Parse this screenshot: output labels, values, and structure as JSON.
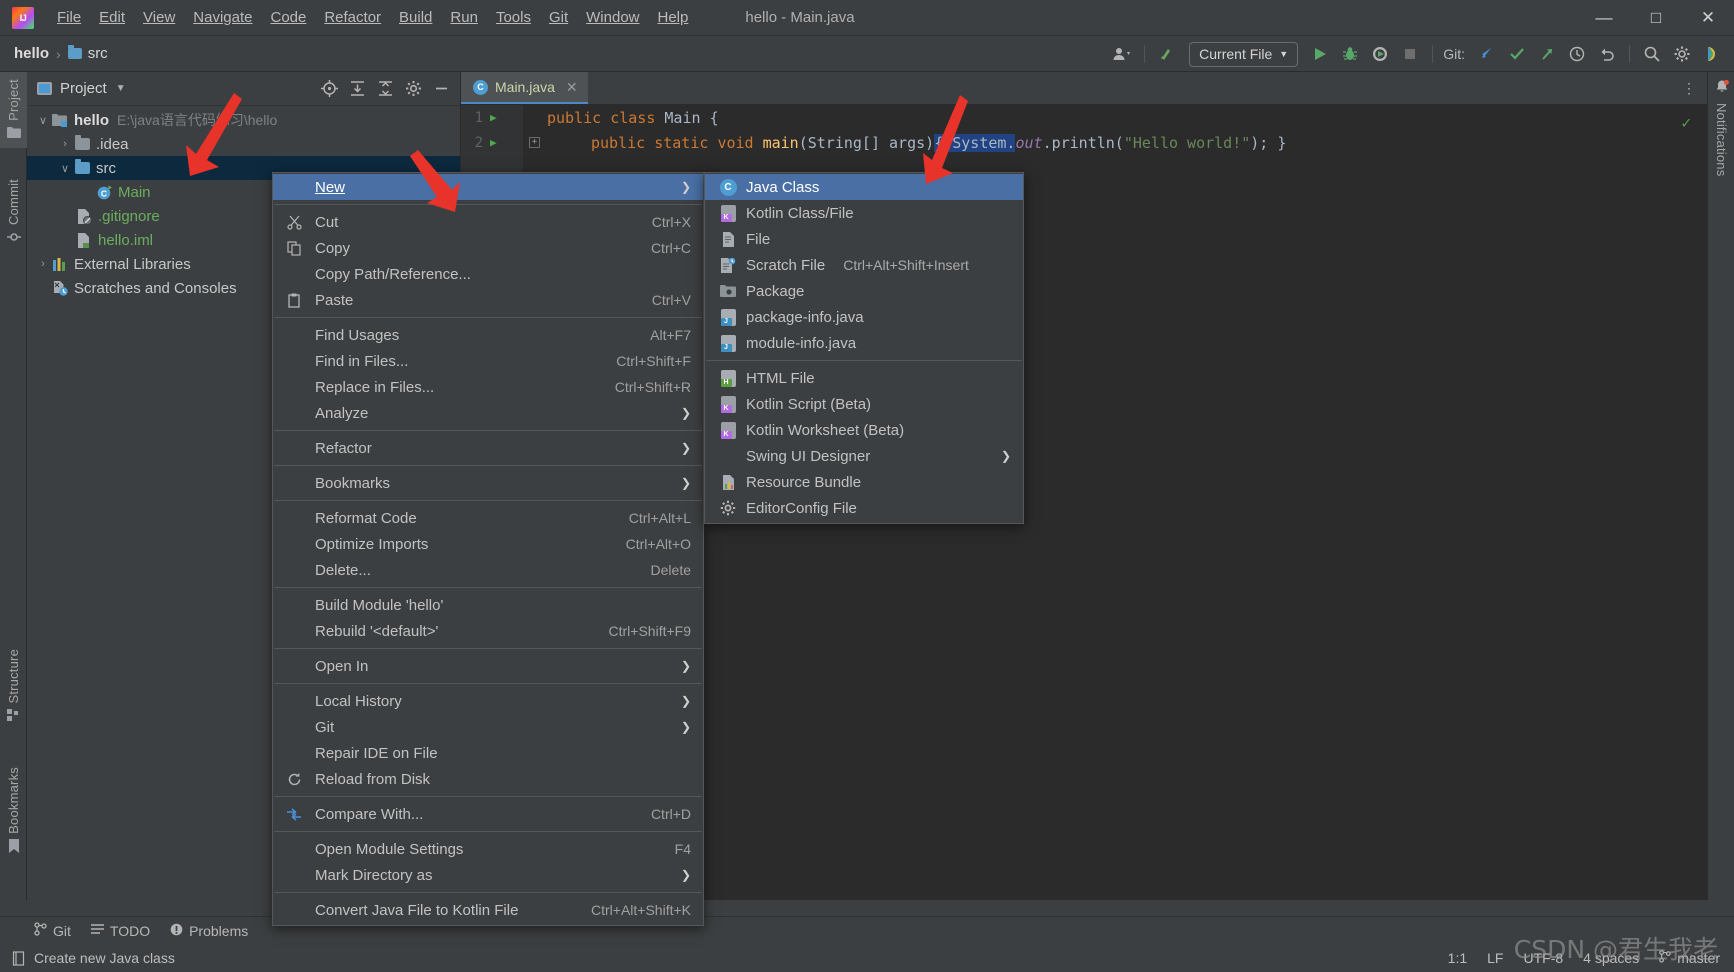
{
  "window": {
    "title": "hello - Main.java",
    "minimize": "—",
    "maximize": "□",
    "close": "✕"
  },
  "menubar": {
    "items": [
      {
        "label": "File"
      },
      {
        "label": "Edit"
      },
      {
        "label": "View"
      },
      {
        "label": "Navigate"
      },
      {
        "label": "Code"
      },
      {
        "label": "Refactor"
      },
      {
        "label": "Build"
      },
      {
        "label": "Run"
      },
      {
        "label": "Tools"
      },
      {
        "label": "Git"
      },
      {
        "label": "Window"
      },
      {
        "label": "Help"
      }
    ]
  },
  "navbar": {
    "breadcrumb": {
      "project": "hello",
      "separator": "›",
      "folder": "src"
    },
    "run_config": "Current File",
    "git_label": "Git:"
  },
  "left_strip": {
    "top": [
      {
        "label": "Project",
        "icon": "project-icon",
        "active": true
      },
      {
        "label": "Commit",
        "icon": "commit-icon",
        "active": false
      }
    ],
    "bottom": [
      {
        "label": "Structure",
        "icon": "structure-icon"
      },
      {
        "label": "Bookmarks",
        "icon": "bookmark-icon"
      }
    ]
  },
  "right_strip": {
    "items": [
      {
        "label": "Notifications",
        "icon": "bell-icon"
      }
    ]
  },
  "project_panel": {
    "title": "Project",
    "tree": [
      {
        "indent": 0,
        "twisty": "∨",
        "icon": "module-icon",
        "label": "hello",
        "bold": true,
        "path": "E:\\java语言代码练习\\hello",
        "selected": false
      },
      {
        "indent": 1,
        "twisty": "›",
        "icon": "folder-gray",
        "label": ".idea",
        "bold": false,
        "path": "",
        "selected": false
      },
      {
        "indent": 1,
        "twisty": "∨",
        "icon": "folder-blue",
        "label": "src",
        "bold": false,
        "path": "",
        "selected": true
      },
      {
        "indent": 2,
        "twisty": "",
        "icon": "class-icon",
        "label": "Main",
        "bold": false,
        "path": "",
        "selected": false,
        "green": true
      },
      {
        "indent": 1,
        "twisty": "",
        "icon": "gitignore-icon",
        "label": ".gitignore",
        "bold": false,
        "path": "",
        "selected": false,
        "green": true
      },
      {
        "indent": 1,
        "twisty": "",
        "icon": "iml-icon",
        "label": "hello.iml",
        "bold": false,
        "path": "",
        "selected": false,
        "green": true
      },
      {
        "indent": 0,
        "twisty": "›",
        "icon": "libraries-icon",
        "label": "External Libraries",
        "bold": false,
        "path": "",
        "selected": false
      },
      {
        "indent": 0,
        "twisty": "",
        "icon": "scratches-icon",
        "label": "Scratches and Consoles",
        "bold": false,
        "path": "",
        "selected": false
      }
    ]
  },
  "editor": {
    "tab": {
      "label": "Main.java",
      "close": "✕"
    },
    "lines": [
      {
        "number": "1",
        "has_run": true,
        "has_fold": false
      },
      {
        "number": "2",
        "has_run": true,
        "has_fold": true
      }
    ],
    "code": {
      "l1_kw1": "public",
      "l1_kw2": "class",
      "l1_name": "Main",
      "l1_brace": "{",
      "l2_kw1": "public",
      "l2_kw2": "static",
      "l2_kw3": "void",
      "l2_name": "main",
      "l2_params": "(String[] args)",
      "l2_body": "{ System.",
      "l2_field": "out",
      "l2_call": ".println(",
      "l2_str": "\"Hello world!\"",
      "l2_tail": "); }"
    }
  },
  "context_menu": {
    "items": [
      {
        "label": "New",
        "accel": "",
        "icon": "",
        "arrow": true,
        "highlight": true,
        "sep_after": true,
        "mnemonic": "N"
      },
      {
        "label": "Cut",
        "accel": "Ctrl+X",
        "icon": "scissors-icon",
        "arrow": false,
        "highlight": false,
        "sep_after": false
      },
      {
        "label": "Copy",
        "accel": "Ctrl+C",
        "icon": "copy-icon",
        "arrow": false,
        "highlight": false,
        "sep_after": false
      },
      {
        "label": "Copy Path/Reference...",
        "accel": "",
        "icon": "",
        "arrow": false,
        "highlight": false,
        "sep_after": false
      },
      {
        "label": "Paste",
        "accel": "Ctrl+V",
        "icon": "clipboard-icon",
        "arrow": false,
        "highlight": false,
        "sep_after": true
      },
      {
        "label": "Find Usages",
        "accel": "Alt+F7",
        "icon": "",
        "arrow": false,
        "highlight": false,
        "sep_after": false
      },
      {
        "label": "Find in Files...",
        "accel": "Ctrl+Shift+F",
        "icon": "",
        "arrow": false,
        "highlight": false,
        "sep_after": false
      },
      {
        "label": "Replace in Files...",
        "accel": "Ctrl+Shift+R",
        "icon": "",
        "arrow": false,
        "highlight": false,
        "sep_after": false
      },
      {
        "label": "Analyze",
        "accel": "",
        "icon": "",
        "arrow": true,
        "highlight": false,
        "sep_after": true
      },
      {
        "label": "Refactor",
        "accel": "",
        "icon": "",
        "arrow": true,
        "highlight": false,
        "sep_after": true
      },
      {
        "label": "Bookmarks",
        "accel": "",
        "icon": "",
        "arrow": true,
        "highlight": false,
        "sep_after": true
      },
      {
        "label": "Reformat Code",
        "accel": "Ctrl+Alt+L",
        "icon": "",
        "arrow": false,
        "highlight": false,
        "sep_after": false
      },
      {
        "label": "Optimize Imports",
        "accel": "Ctrl+Alt+O",
        "icon": "",
        "arrow": false,
        "highlight": false,
        "sep_after": false
      },
      {
        "label": "Delete...",
        "accel": "Delete",
        "icon": "",
        "arrow": false,
        "highlight": false,
        "sep_after": true
      },
      {
        "label": "Build Module 'hello'",
        "accel": "",
        "icon": "",
        "arrow": false,
        "highlight": false,
        "sep_after": false
      },
      {
        "label": "Rebuild '<default>'",
        "accel": "Ctrl+Shift+F9",
        "icon": "",
        "arrow": false,
        "highlight": false,
        "sep_after": true
      },
      {
        "label": "Open In",
        "accel": "",
        "icon": "",
        "arrow": true,
        "highlight": false,
        "sep_after": true
      },
      {
        "label": "Local History",
        "accel": "",
        "icon": "",
        "arrow": true,
        "highlight": false,
        "sep_after": false
      },
      {
        "label": "Git",
        "accel": "",
        "icon": "",
        "arrow": true,
        "highlight": false,
        "sep_after": false
      },
      {
        "label": "Repair IDE on File",
        "accel": "",
        "icon": "",
        "arrow": false,
        "highlight": false,
        "sep_after": false
      },
      {
        "label": "Reload from Disk",
        "accel": "",
        "icon": "reload-icon",
        "arrow": false,
        "highlight": false,
        "sep_after": true
      },
      {
        "label": "Compare With...",
        "accel": "Ctrl+D",
        "icon": "compare-icon",
        "arrow": false,
        "highlight": false,
        "sep_after": true
      },
      {
        "label": "Open Module Settings",
        "accel": "F4",
        "icon": "",
        "arrow": false,
        "highlight": false,
        "sep_after": false
      },
      {
        "label": "Mark Directory as",
        "accel": "",
        "icon": "",
        "arrow": true,
        "highlight": false,
        "sep_after": true
      },
      {
        "label": "Convert Java File to Kotlin File",
        "accel": "Ctrl+Alt+Shift+K",
        "icon": "",
        "arrow": false,
        "highlight": false,
        "sep_after": false
      }
    ]
  },
  "submenu": {
    "items": [
      {
        "label": "Java Class",
        "accel": "",
        "icon": "java-class-icon",
        "arrow": false,
        "highlight": true,
        "sep_after": false
      },
      {
        "label": "Kotlin Class/File",
        "accel": "",
        "icon": "kotlin-file-icon",
        "arrow": false,
        "highlight": false,
        "sep_after": false
      },
      {
        "label": "File",
        "accel": "",
        "icon": "file-icon",
        "arrow": false,
        "highlight": false,
        "sep_after": false
      },
      {
        "label": "Scratch File",
        "accel": "Ctrl+Alt+Shift+Insert",
        "icon": "scratch-file-icon",
        "arrow": false,
        "highlight": false,
        "sep_after": false
      },
      {
        "label": "Package",
        "accel": "",
        "icon": "package-icon",
        "arrow": false,
        "highlight": false,
        "sep_after": false
      },
      {
        "label": "package-info.java",
        "accel": "",
        "icon": "java-file-icon",
        "arrow": false,
        "highlight": false,
        "sep_after": false
      },
      {
        "label": "module-info.java",
        "accel": "",
        "icon": "java-file-icon",
        "arrow": false,
        "highlight": false,
        "sep_after": true
      },
      {
        "label": "HTML File",
        "accel": "",
        "icon": "html-file-icon",
        "arrow": false,
        "highlight": false,
        "sep_after": false
      },
      {
        "label": "Kotlin Script (Beta)",
        "accel": "",
        "icon": "kotlin-file-icon",
        "arrow": false,
        "highlight": false,
        "sep_after": false
      },
      {
        "label": "Kotlin Worksheet (Beta)",
        "accel": "",
        "icon": "kotlin-file-icon",
        "arrow": false,
        "highlight": false,
        "sep_after": false
      },
      {
        "label": "Swing UI Designer",
        "accel": "",
        "icon": "",
        "arrow": true,
        "highlight": false,
        "sep_after": false
      },
      {
        "label": "Resource Bundle",
        "accel": "",
        "icon": "resource-bundle-icon",
        "arrow": false,
        "highlight": false,
        "sep_after": false
      },
      {
        "label": "EditorConfig File",
        "accel": "",
        "icon": "gear-icon",
        "arrow": false,
        "highlight": false,
        "sep_after": false
      }
    ]
  },
  "bottom_bar": {
    "items": [
      {
        "label": "Git",
        "icon": "git-branch-icon"
      },
      {
        "label": "TODO",
        "icon": "todo-icon"
      },
      {
        "label": "Problems",
        "icon": "problems-icon"
      }
    ]
  },
  "status_bar": {
    "message": "Create new Java class",
    "caret": "1:1",
    "line_sep": "LF",
    "encoding": "UTF-8",
    "indent": "4 spaces",
    "branch": "master",
    "watermark": "CSDN @君生我老"
  },
  "colors": {
    "accent": "#4a6fa5",
    "selection": "#0d293e",
    "panel": "#3c3f41",
    "editor_bg": "#2b2b2b",
    "arrow_red": "#e8332a"
  }
}
